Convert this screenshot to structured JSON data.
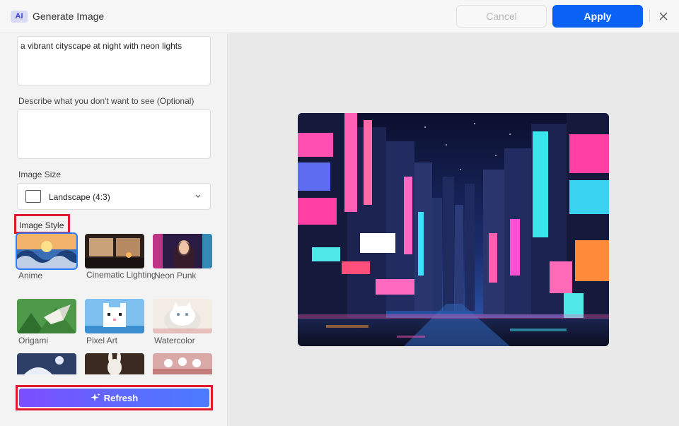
{
  "window": {
    "badge": "AI",
    "title": "Generate Image",
    "cancel_label": "Cancel",
    "apply_label": "Apply",
    "close_icon": "close-icon"
  },
  "form": {
    "prompt_value": "a vibrant cityscape at night with neon lights",
    "negative_label": "Describe what you don't want to see (Optional)",
    "negative_value": "",
    "size_label": "Image Size",
    "size_value": "Landscape (4:3)",
    "style_label": "Image Style"
  },
  "styles": [
    {
      "name": "Anime",
      "selected": true
    },
    {
      "name": "Cinematic Lighting",
      "selected": false
    },
    {
      "name": "Neon Punk",
      "selected": false
    },
    {
      "name": "Origami",
      "selected": false
    },
    {
      "name": "Pixel Art",
      "selected": false
    },
    {
      "name": "Watercolor",
      "selected": false
    }
  ],
  "refresh_label": "Refresh",
  "colors": {
    "accent": "#0a62f5",
    "highlight": "#e0192e",
    "gradient_start": "#7c4dff",
    "gradient_end": "#4a7bff"
  }
}
